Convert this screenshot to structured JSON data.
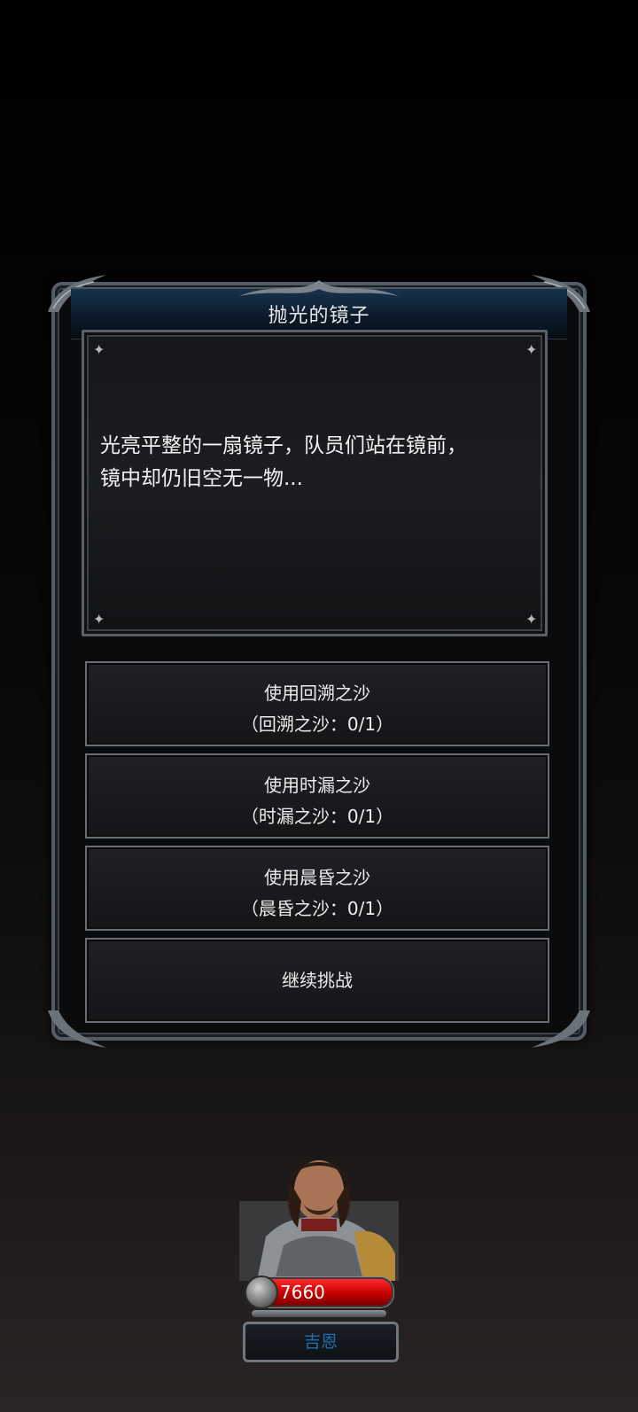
{
  "dialog": {
    "title": "抛光的镜子",
    "description_lines": [
      "光亮平整的一扇镜子，队员们站在镜前，",
      "镜中却仍旧空无一物..."
    ]
  },
  "options": [
    {
      "label": "使用回溯之沙",
      "detail": "（回溯之沙：0/1）"
    },
    {
      "label": "使用时漏之沙",
      "detail": "（时漏之沙：0/1）"
    },
    {
      "label": "使用晨昏之沙",
      "detail": "（晨昏之沙：0/1）"
    },
    {
      "label": "继续挑战"
    }
  ],
  "hero": {
    "hp": "7660",
    "name": "吉恩"
  },
  "colors": {
    "hp_bar": "#e00000",
    "title_bar": "#17314b",
    "name_text": "#1f6fae"
  }
}
